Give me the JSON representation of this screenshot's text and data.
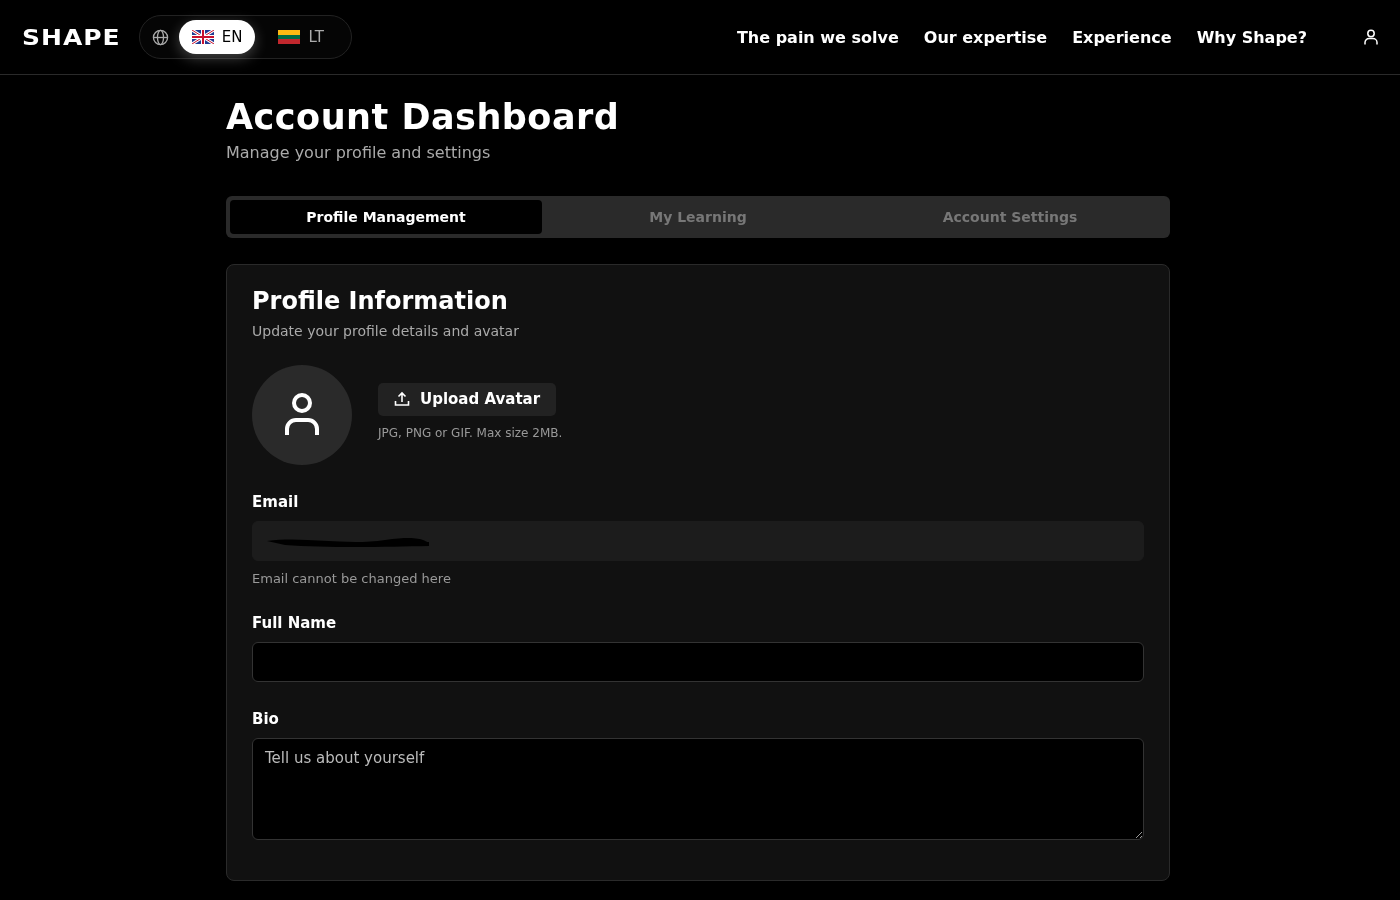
{
  "header": {
    "logo": "SHAPE",
    "languages": [
      {
        "code": "EN",
        "selected": true
      },
      {
        "code": "LT",
        "selected": false
      }
    ],
    "nav": [
      "The pain we solve",
      "Our expertise",
      "Experience",
      "Why Shape?"
    ]
  },
  "page": {
    "title": "Account Dashboard",
    "subtitle": "Manage your profile and settings"
  },
  "tabs": [
    {
      "label": "Profile Management",
      "selected": true
    },
    {
      "label": "My Learning",
      "selected": false
    },
    {
      "label": "Account Settings",
      "selected": false
    }
  ],
  "profile": {
    "title": "Profile Information",
    "subtitle": "Update your profile details and avatar",
    "upload_button": "Upload Avatar",
    "upload_hint": "JPG, PNG or GIF. Max size 2MB.",
    "fields": [
      {
        "kind": "readonly",
        "label": "Email",
        "hint": "Email cannot be changed here"
      },
      {
        "kind": "input",
        "label": "Full Name"
      },
      {
        "kind": "textarea",
        "label": "Bio",
        "placeholder": "Tell us about yourself"
      }
    ]
  }
}
